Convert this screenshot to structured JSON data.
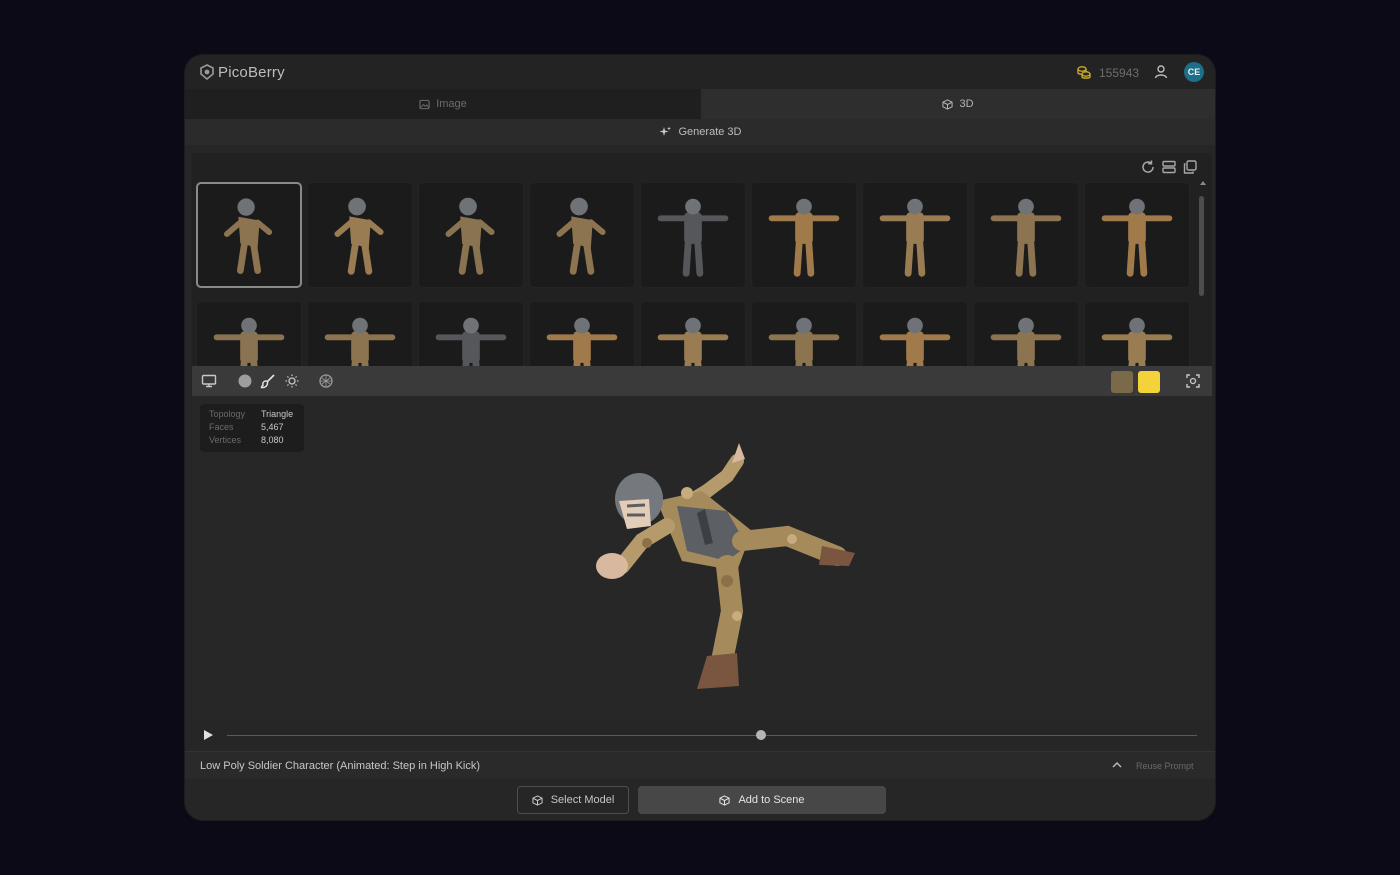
{
  "app": {
    "brand": "PicoBerry",
    "coin_count": "155943",
    "avatar_initials": "CE"
  },
  "tabs": [
    {
      "label": "Image",
      "icon": "image-icon",
      "active": false
    },
    {
      "label": "3D",
      "icon": "cube-icon",
      "active": true
    }
  ],
  "generate": {
    "label": "Generate 3D",
    "icon": "sparkle-icon"
  },
  "gallery": {
    "tools": [
      "refresh-icon",
      "list-layout-icon",
      "copy-icon"
    ],
    "selected_index": 0,
    "rows": 2,
    "columns": 9
  },
  "viewer": {
    "toolbar_left": [
      "monitor-icon",
      "solid-shading-icon",
      "brush-icon",
      "light-icon",
      "texture-icon"
    ],
    "swatches": [
      {
        "name": "camo-texture-swatch",
        "color": "#7a6a4a"
      },
      {
        "name": "yellow-swatch",
        "color": "#f3d23a"
      }
    ],
    "toolbar_right": "focus-frame-icon",
    "stats": [
      {
        "key": "Topology",
        "value": "Triangle"
      },
      {
        "key": "Faces",
        "value": "5,467"
      },
      {
        "key": "Vertices",
        "value": "8,080"
      }
    ],
    "playback_progress": 0.55
  },
  "prompt": {
    "text": "Low Poly Soldier Character (Animated: Step in High Kick)",
    "reuse_label": "Reuse Prompt"
  },
  "actions": {
    "select_label": "Select Model",
    "add_label": "Add to Scene"
  },
  "colors": {
    "accent": "#f3d23a",
    "background": "#0c0a17",
    "panel": "#262626"
  }
}
